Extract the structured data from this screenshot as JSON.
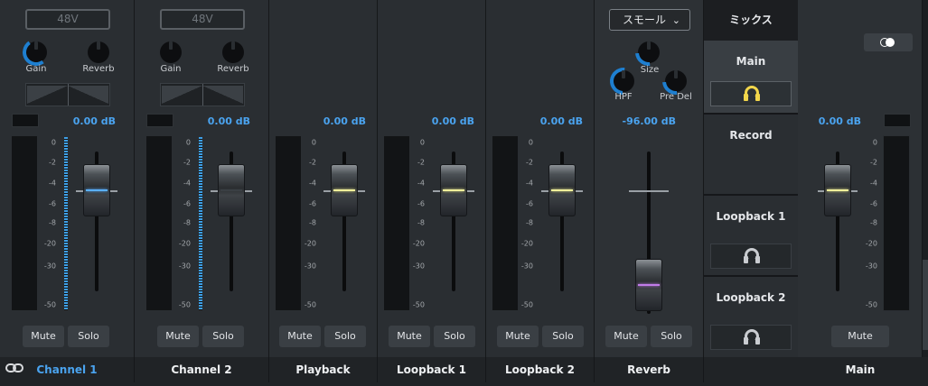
{
  "strips": [
    {
      "name": "Channel 1",
      "btn48": "48V",
      "knob1": "Gain",
      "knob2": "Reverb",
      "db": "0.00 dB",
      "mute": "Mute",
      "solo": "Solo"
    },
    {
      "name": "Channel 2",
      "btn48": "48V",
      "knob1": "Gain",
      "knob2": "Reverb",
      "db": "0.00 dB",
      "mute": "Mute",
      "solo": "Solo"
    },
    {
      "name": "Playback",
      "db": "0.00 dB",
      "mute": "Mute",
      "solo": "Solo"
    },
    {
      "name": "Loopback 1",
      "db": "0.00 dB",
      "mute": "Mute",
      "solo": "Solo"
    },
    {
      "name": "Loopback 2",
      "db": "0.00 dB",
      "mute": "Mute",
      "solo": "Solo"
    },
    {
      "name": "Reverb",
      "room": "スモール",
      "knob_size": "Size",
      "knob_hpf": "HPF",
      "knob_predel": "Pre Del",
      "db": "-96.00 dB",
      "mute": "Mute",
      "solo": "Solo"
    }
  ],
  "scale": [
    "0",
    "-2",
    "-4",
    "-6",
    "-8",
    "-10",
    "-20",
    "-30",
    "-50"
  ],
  "mix": {
    "header": "ミックス",
    "items": [
      "Main",
      "Record",
      "Loopback 1",
      "Loopback 2"
    ]
  },
  "main_strip": {
    "name": "Main",
    "db": "0.00 dB",
    "mute": "Mute"
  },
  "colors": {
    "accent": "#4aa3ef",
    "headphone_active": "#f2d64b"
  }
}
